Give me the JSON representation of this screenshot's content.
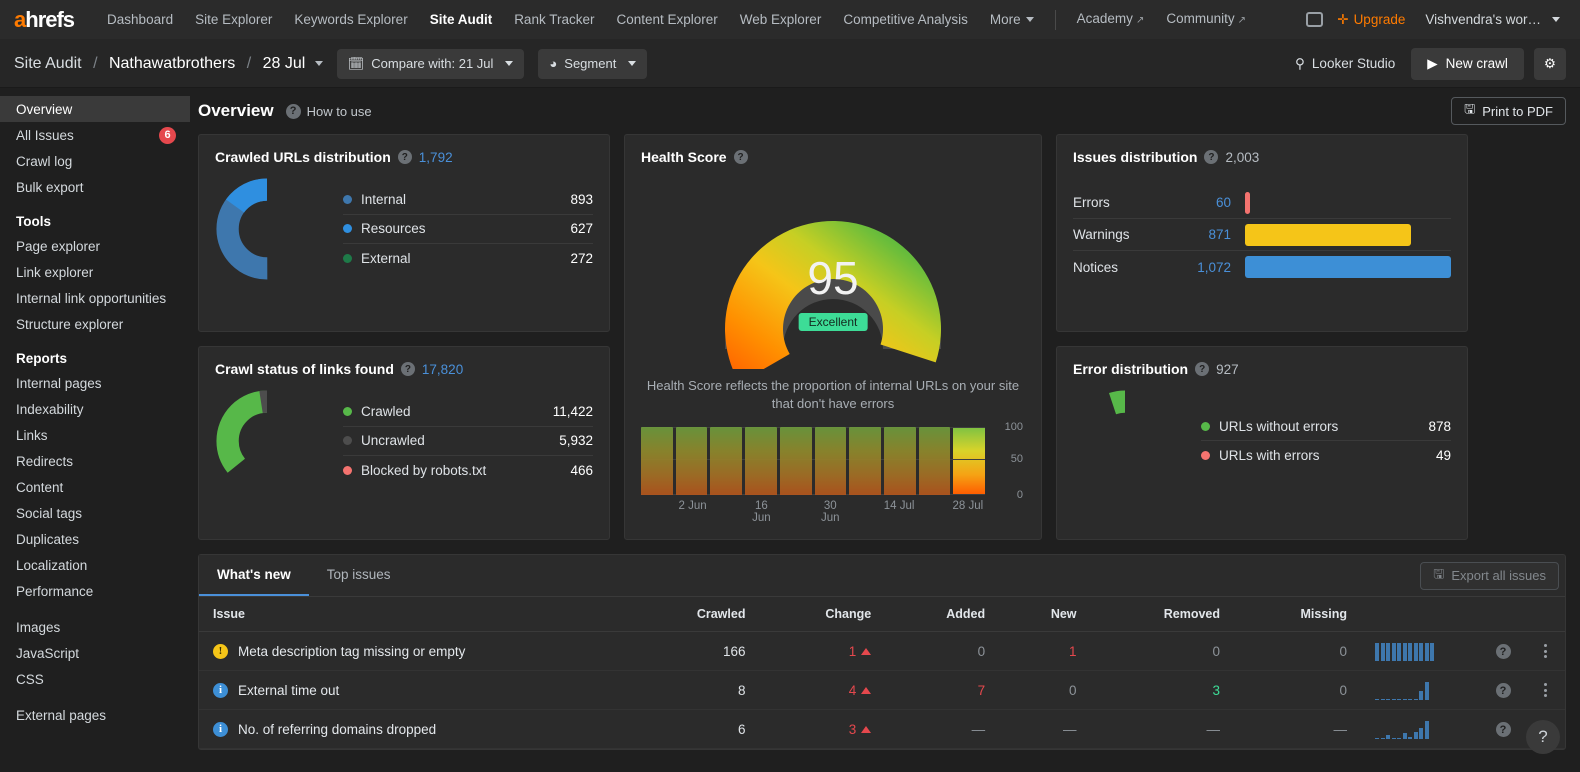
{
  "topnav": {
    "logo": "ahrefs",
    "links": [
      {
        "label": "Dashboard",
        "active": false,
        "external": false
      },
      {
        "label": "Site Explorer",
        "active": false,
        "external": false
      },
      {
        "label": "Keywords Explorer",
        "active": false,
        "external": false
      },
      {
        "label": "Site Audit",
        "active": true,
        "external": false
      },
      {
        "label": "Rank Tracker",
        "active": false,
        "external": false
      },
      {
        "label": "Content Explorer",
        "active": false,
        "external": false
      },
      {
        "label": "Web Explorer",
        "active": false,
        "external": false
      },
      {
        "label": "Competitive Analysis",
        "active": false,
        "external": false
      },
      {
        "label": "More",
        "active": false,
        "external": false,
        "caret": true
      }
    ],
    "secondary_links": [
      {
        "label": "Academy",
        "external": true
      },
      {
        "label": "Community",
        "external": true
      }
    ],
    "upgrade_label": "Upgrade",
    "workspace": "Vishvendra's wor…"
  },
  "subbar": {
    "breadcrumb": {
      "app": "Site Audit",
      "project": "Nathawatbrothers",
      "date": "28 Jul"
    },
    "compare_label": "Compare with: 21 Jul",
    "segment_label": "Segment",
    "looker_label": "Looker Studio",
    "new_crawl_label": "New crawl"
  },
  "sidebar": {
    "groups": [
      {
        "heading": null,
        "items": [
          {
            "label": "Overview",
            "active": true,
            "badge": null
          },
          {
            "label": "All Issues",
            "active": false,
            "badge": "6"
          },
          {
            "label": "Crawl log",
            "active": false,
            "badge": null
          },
          {
            "label": "Bulk export",
            "active": false,
            "badge": null
          }
        ]
      },
      {
        "heading": "Tools",
        "items": [
          {
            "label": "Page explorer",
            "active": false,
            "badge": null
          },
          {
            "label": "Link explorer",
            "active": false,
            "badge": null
          },
          {
            "label": "Internal link opportunities",
            "active": false,
            "badge": null
          },
          {
            "label": "Structure explorer",
            "active": false,
            "badge": null
          }
        ]
      },
      {
        "heading": "Reports",
        "items": [
          {
            "label": "Internal pages",
            "active": false,
            "badge": null
          },
          {
            "label": "Indexability",
            "active": false,
            "badge": null
          },
          {
            "label": "Links",
            "active": false,
            "badge": null
          },
          {
            "label": "Redirects",
            "active": false,
            "badge": null
          },
          {
            "label": "Content",
            "active": false,
            "badge": null
          },
          {
            "label": "Social tags",
            "active": false,
            "badge": null
          },
          {
            "label": "Duplicates",
            "active": false,
            "badge": null
          },
          {
            "label": "Localization",
            "active": false,
            "badge": null
          },
          {
            "label": "Performance",
            "active": false,
            "badge": null
          }
        ]
      },
      {
        "heading": null,
        "items": [
          {
            "label": "Images",
            "active": false,
            "badge": null
          },
          {
            "label": "JavaScript",
            "active": false,
            "badge": null
          },
          {
            "label": "CSS",
            "active": false,
            "badge": null
          }
        ]
      },
      {
        "heading": null,
        "items": [
          {
            "label": "External pages",
            "active": false,
            "badge": null
          }
        ]
      }
    ]
  },
  "page": {
    "title": "Overview",
    "how_to_use": "How to use",
    "print_pdf": "Print to PDF"
  },
  "cards": {
    "crawled_urls": {
      "title": "Crawled URLs distribution",
      "total": "1,792",
      "legend": [
        {
          "label": "Internal",
          "value": "893",
          "color": "#3e77ad",
          "pct": 49.8
        },
        {
          "label": "Resources",
          "value": "627",
          "color": "#2f8fe0",
          "pct": 35.0
        },
        {
          "label": "External",
          "value": "272",
          "color": "#1e7a48",
          "pct": 15.2
        }
      ]
    },
    "crawl_status": {
      "title": "Crawl status of links found",
      "total": "17,820",
      "legend": [
        {
          "label": "Crawled",
          "value": "11,422",
          "color": "#57b849",
          "pct": 64.1
        },
        {
          "label": "Uncrawled",
          "value": "5,932",
          "color": "#4d4d4d",
          "pct": 33.3
        },
        {
          "label": "Blocked by robots.txt",
          "value": "466",
          "color": "#f4736f",
          "pct": 2.6
        }
      ]
    },
    "health_score": {
      "title": "Health Score",
      "score": "95",
      "rating": "Excellent",
      "description": "Health Score reflects the proportion of internal URLs on your site that don't have errors",
      "axis_labels": [
        "100",
        "50",
        "0"
      ],
      "x_labels": [
        "",
        "2 Jun",
        "",
        "16 Jun",
        "",
        "30 Jun",
        "",
        "14 Jul",
        "",
        "28 Jul"
      ]
    },
    "issues_distribution": {
      "title": "Issues distribution",
      "total": "2,003",
      "rows": [
        {
          "label": "Errors",
          "value": "60",
          "color": "#f4736f",
          "pct": 2.6
        },
        {
          "label": "Warnings",
          "value": "871",
          "color": "#f5c518",
          "pct": 80.8
        },
        {
          "label": "Notices",
          "value": "1,072",
          "color": "#3d8fd6",
          "pct": 100
        }
      ]
    },
    "error_distribution": {
      "title": "Error distribution",
      "total": "927",
      "legend": [
        {
          "label": "URLs without errors",
          "value": "878",
          "color": "#57b849",
          "pct": 94.7
        },
        {
          "label": "URLs with errors",
          "value": "49",
          "color": "#f4736f",
          "pct": 5.3
        }
      ]
    }
  },
  "bottom": {
    "tabs": [
      {
        "label": "What's new",
        "active": true
      },
      {
        "label": "Top issues",
        "active": false
      }
    ],
    "export_label": "Export all issues",
    "columns": [
      "Issue",
      "Crawled",
      "Change",
      "Added",
      "New",
      "Removed",
      "Missing"
    ],
    "rows": [
      {
        "severity": "warning",
        "issue": "Meta description tag missing or empty",
        "crawled": "166",
        "change": "1",
        "change_dir": "up",
        "added": "0",
        "added_color": "muted",
        "new": "1",
        "new_color": "red",
        "removed": "0",
        "removed_color": "muted",
        "missing": "0",
        "missing_color": "muted",
        "spark": [
          14,
          14,
          14,
          14,
          14,
          14,
          14,
          14,
          14,
          14,
          14
        ]
      },
      {
        "severity": "notice",
        "issue": "External time out",
        "crawled": "8",
        "change": "4",
        "change_dir": "up",
        "added": "7",
        "added_color": "red",
        "new": "0",
        "new_color": "muted",
        "removed": "3",
        "removed_color": "green",
        "missing": "0",
        "missing_color": "muted",
        "spark": [
          1,
          1,
          1,
          1,
          1,
          1,
          1,
          1,
          7,
          14
        ]
      },
      {
        "severity": "notice",
        "issue": "No. of referring domains dropped",
        "crawled": "6",
        "change": "3",
        "change_dir": "up",
        "added": "—",
        "added_color": "muted",
        "new": "—",
        "new_color": "muted",
        "removed": "—",
        "removed_color": "muted",
        "missing": "—",
        "missing_color": "muted",
        "spark": [
          1,
          1,
          3,
          1,
          1,
          5,
          2,
          6,
          9,
          15
        ]
      }
    ]
  },
  "help_fab": "?",
  "colors": {
    "accent_blue": "#4a90d9",
    "brand_orange": "#ff7b00",
    "error_red": "#e5484d",
    "good_green": "#3ddc97"
  }
}
